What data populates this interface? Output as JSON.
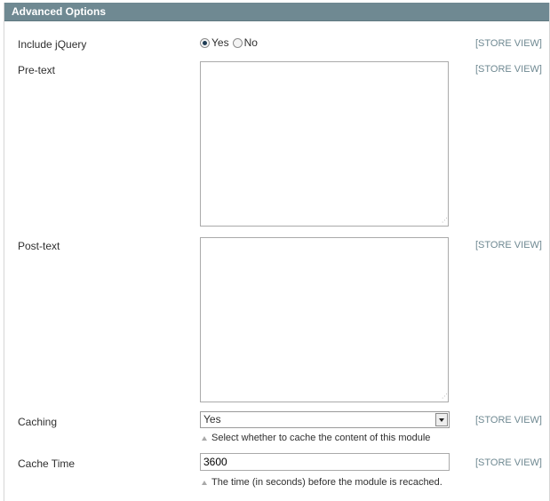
{
  "section": {
    "title": "Advanced Options"
  },
  "rows": {
    "include_jquery": {
      "label": "Include jQuery",
      "options": [
        "Yes",
        "No"
      ],
      "selected": "Yes",
      "scope": "[STORE VIEW]"
    },
    "pre_text": {
      "label": "Pre-text",
      "value": "",
      "scope": "[STORE VIEW]"
    },
    "post_text": {
      "label": "Post-text",
      "value": "",
      "scope": "[STORE VIEW]"
    },
    "caching": {
      "label": "Caching",
      "value": "Yes",
      "note": "Select whether to cache the content of this module",
      "scope": "[STORE VIEW]"
    },
    "cache_time": {
      "label": "Cache Time",
      "value": "3600",
      "note": "The time (in seconds) before the module is recached.",
      "scope": "[STORE VIEW]"
    }
  },
  "colors": {
    "header_bg": "#6f8992",
    "scope_text": "#6f8992"
  }
}
